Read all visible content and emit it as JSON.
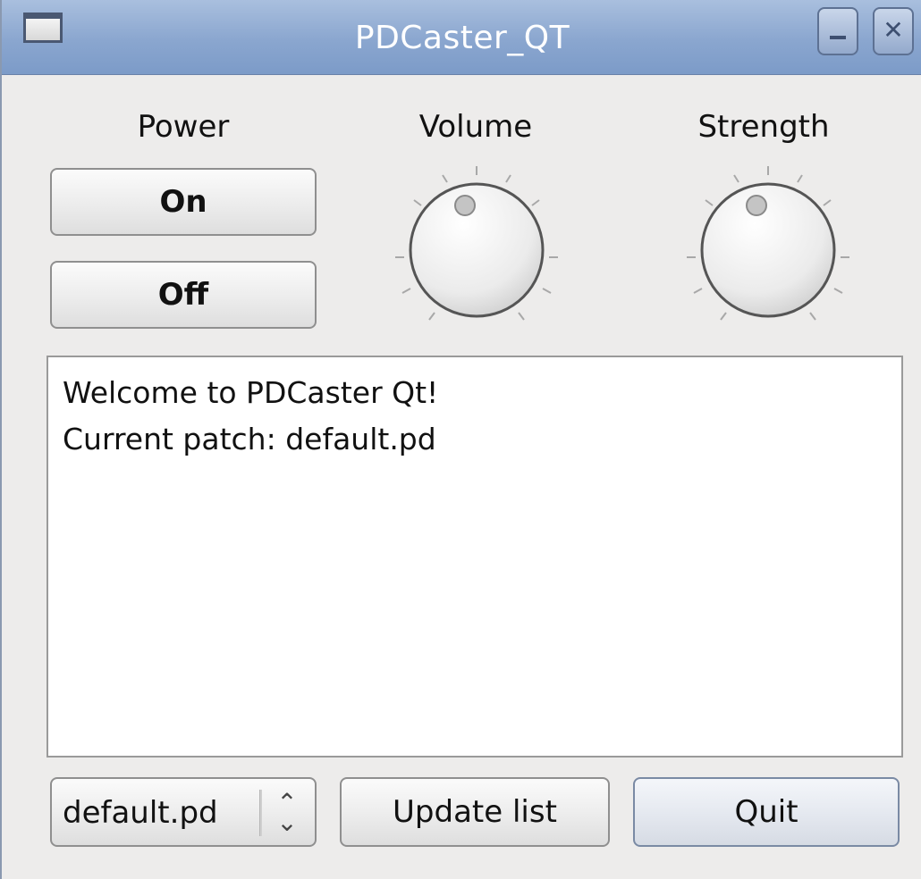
{
  "window": {
    "title": "PDCaster_QT"
  },
  "power": {
    "label": "Power",
    "on_label": "On",
    "off_label": "Off"
  },
  "volume": {
    "label": "Volume"
  },
  "strength": {
    "label": "Strength"
  },
  "output": {
    "lines": [
      "Welcome to PDCaster Qt!",
      "Current patch: default.pd"
    ]
  },
  "bottom": {
    "patch_select_value": "default.pd",
    "update_label": "Update list",
    "quit_label": "Quit"
  },
  "icons": {
    "window_icon": "window-icon",
    "minimize": "minimize-icon",
    "close": "close-icon",
    "combo_arrow": "up-down-arrows-icon"
  }
}
